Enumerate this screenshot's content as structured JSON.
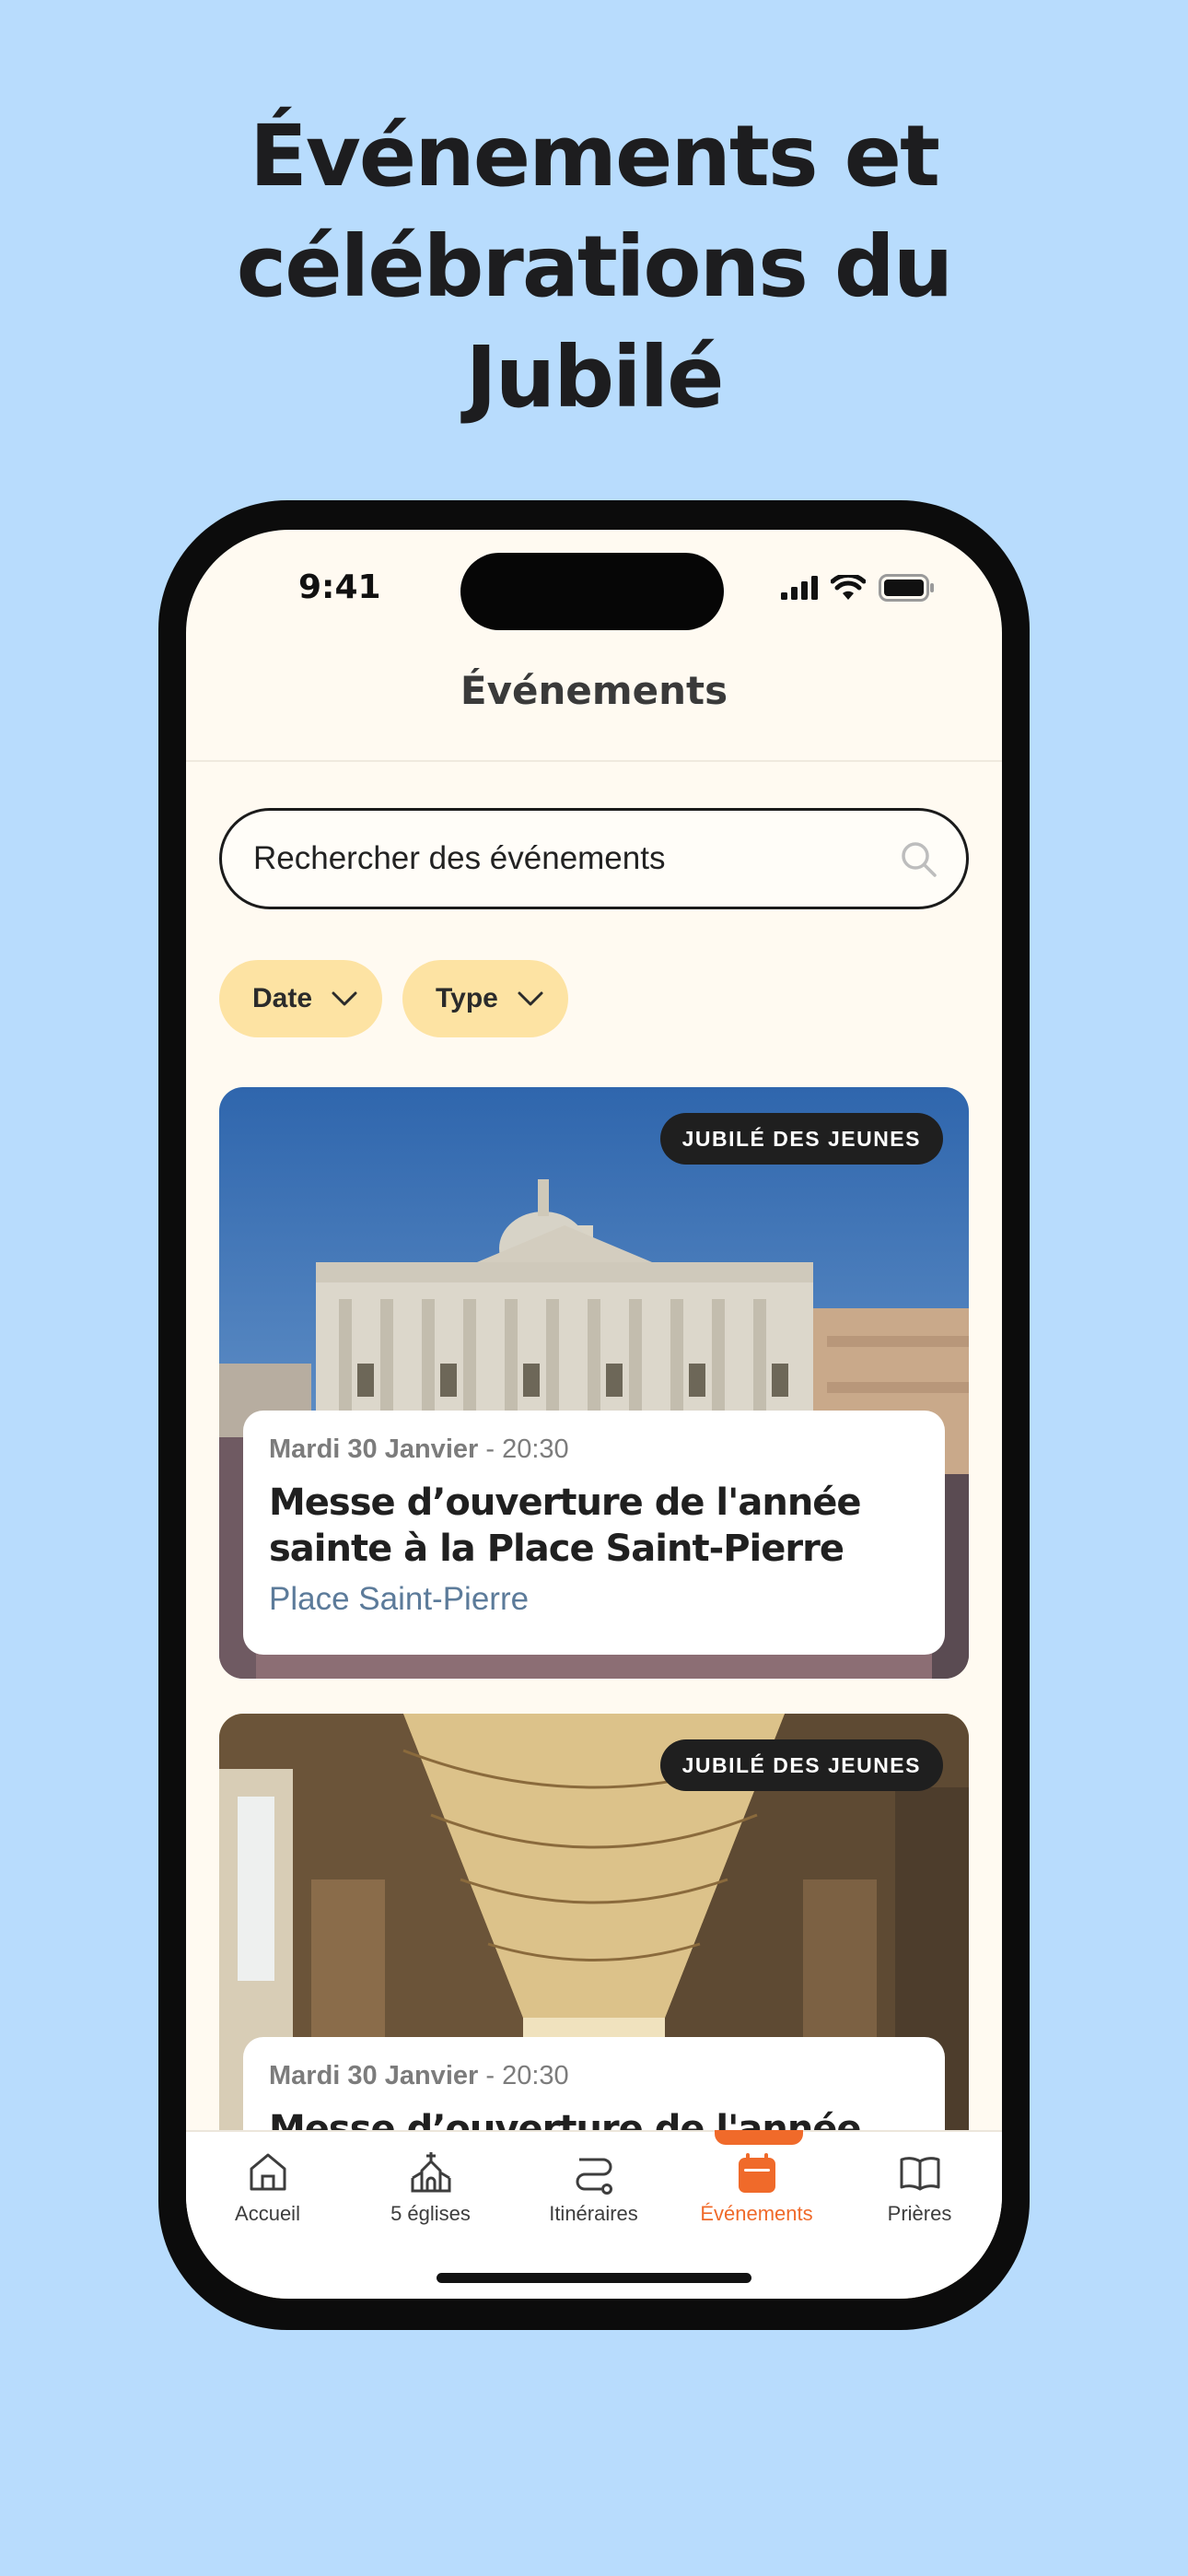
{
  "headline": {
    "line1": "Événements et",
    "line2": "célébrations du",
    "line3": "Jubilé"
  },
  "status_bar": {
    "time": "9:41"
  },
  "nav": {
    "title": "Événements"
  },
  "search": {
    "placeholder": "Rechercher des événements"
  },
  "filters": [
    {
      "label": "Date"
    },
    {
      "label": "Type"
    }
  ],
  "events": [
    {
      "badge": "JUBILÉ DES JEUNES",
      "date": "Mardi 30 Janvier",
      "time": "20:30",
      "title_line1": "Messe d’ouverture de l'année",
      "title_line2": "sainte à la Place Saint-Pierre",
      "location": "Place Saint-Pierre",
      "image": "st-peters-basilica-photo"
    },
    {
      "badge": "JUBILÉ DES JEUNES",
      "date": "Mardi 30 Janvier",
      "time": "20:30",
      "title_line1": "Messe d’ouverture de l'année",
      "image": "vatican-gallery-ceiling-photo"
    }
  ],
  "tabs": [
    {
      "label": "Accueil",
      "icon": "home-icon"
    },
    {
      "label": "5 églises",
      "icon": "church-icon"
    },
    {
      "label": "Itinéraires",
      "icon": "route-icon"
    },
    {
      "label": "Événements",
      "icon": "calendar-icon",
      "active": true
    },
    {
      "label": "Prières",
      "icon": "book-icon"
    }
  ],
  "colors": {
    "background": "#b8dcfd",
    "screen": "#fffaf1",
    "chip": "#fde3a3",
    "accent": "#f06a2a",
    "location": "#5c7b9a"
  }
}
